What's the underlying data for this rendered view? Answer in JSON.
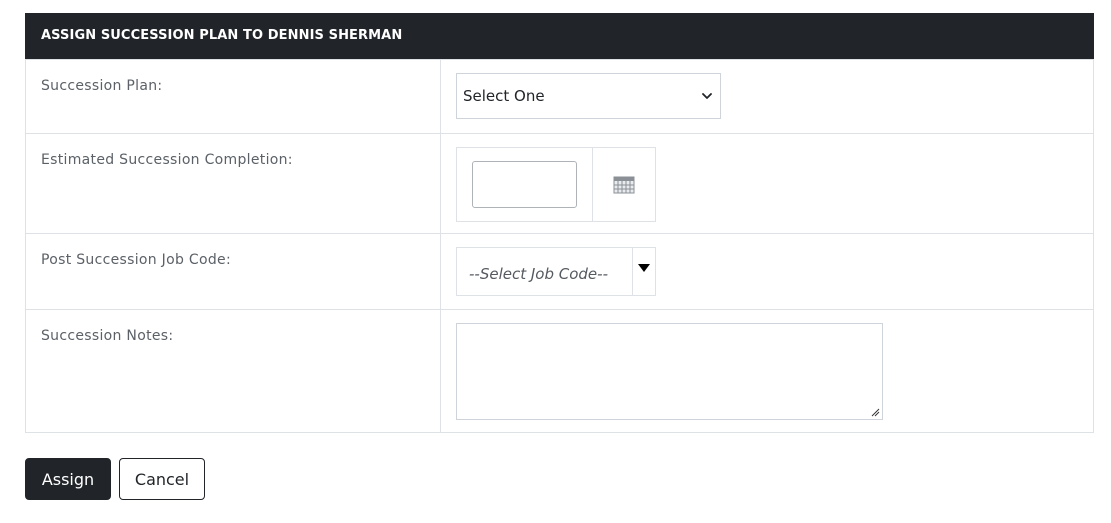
{
  "panel": {
    "title": "ASSIGN SUCCESSION PLAN TO DENNIS SHERMAN"
  },
  "fields": {
    "succession_plan": {
      "label": "Succession Plan:",
      "selected": "Select One",
      "icon": "chevron-down-icon"
    },
    "completion": {
      "label": "Estimated Succession Completion:",
      "value": "",
      "icon": "calendar-icon"
    },
    "job_code": {
      "label": "Post Succession Job Code:",
      "selected": "--Select Job Code--",
      "icon": "caret-down-icon"
    },
    "notes": {
      "label": "Succession Notes:",
      "value": ""
    }
  },
  "actions": {
    "assign_label": "Assign",
    "cancel_label": "Cancel"
  },
  "colors": {
    "header_bg": "#212529",
    "border": "#dee2e6",
    "label_text": "#5b6167"
  }
}
